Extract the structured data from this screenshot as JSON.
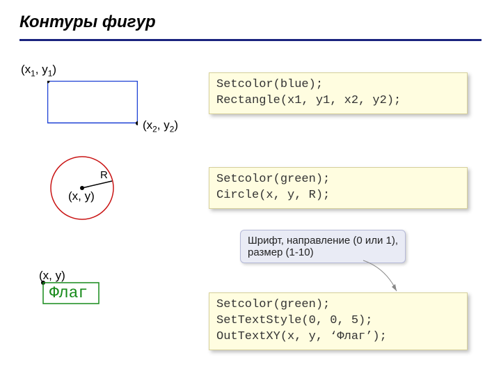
{
  "title": "Контуры фигур",
  "rect": {
    "label_tl_open": "(x",
    "label_tl_sub1": "1",
    "label_tl_mid": ", y",
    "label_tl_sub2": "1",
    "label_tl_close": ")",
    "label_br_open": "(x",
    "label_br_sub1": "2",
    "label_br_mid": ", y",
    "label_br_sub2": "2",
    "label_br_close": ")"
  },
  "circle": {
    "center_label": "(x, y)",
    "radius_label": "R"
  },
  "text_demo": {
    "anchor_label": "(x, y)",
    "word": "Флаг"
  },
  "code_rect_line1": "Setcolor(blue);",
  "code_rect_line2": "Rectangle(x1, y1, x2, y2);",
  "code_circle_line1": "Setcolor(green);",
  "code_circle_line2": "Circle(x, y, R);",
  "code_text_line1": "Setcolor(green);",
  "code_text_line2": "SetTextStyle(0, 0, 5);",
  "code_text_line3": "OutTextXY(x, y, ‘Флаг’);",
  "callout_line1": "Шрифт, направление (0 или 1),",
  "callout_line2": "размер (1-10)"
}
